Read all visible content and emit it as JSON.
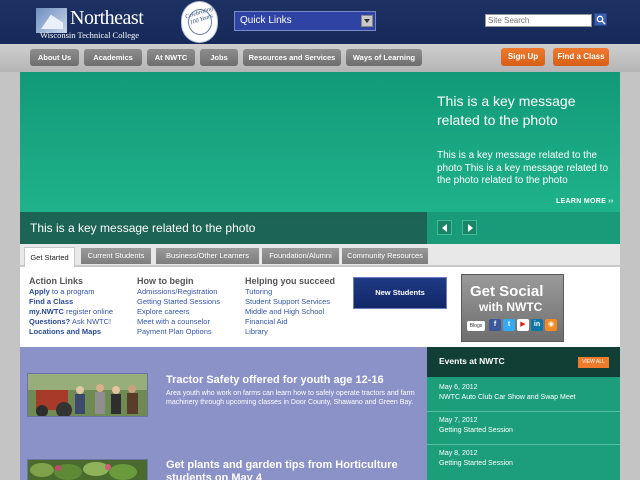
{
  "header": {
    "logo": {
      "name": "Northeast",
      "subtitle": "Wisconsin Technical College"
    },
    "seal": {
      "text": "Celebrating 100 Years"
    },
    "quick_links": {
      "label": "Quick Links"
    },
    "search": {
      "placeholder": "Site Search",
      "button_icon": "magnifier-icon"
    }
  },
  "nav": {
    "items": [
      {
        "label": "About Us"
      },
      {
        "label": "Academics"
      },
      {
        "label": "At NWTC"
      },
      {
        "label": "Jobs"
      },
      {
        "label": "Resources and Services"
      },
      {
        "label": "Ways of Learning"
      }
    ],
    "cta": [
      {
        "label": "Sign Up"
      },
      {
        "label": "Find a Class"
      }
    ]
  },
  "hero": {
    "title": "This is a key message related to the photo",
    "body": "This is a key message related to the photo This is a key message related to the photo related to the photo",
    "learn_more": "LEARN MORE ››",
    "caption": "This is a key message related to the photo",
    "controls": [
      "prev-arrow-icon",
      "next-arrow-icon"
    ]
  },
  "tabs": [
    {
      "label": "Get Started",
      "active": true
    },
    {
      "label": "Current Students",
      "active": false
    },
    {
      "label": "Business/Other Learners",
      "active": false
    },
    {
      "label": "Foundation/Alumni",
      "active": false
    },
    {
      "label": "Community Resources",
      "active": false
    }
  ],
  "panel": {
    "columns": [
      {
        "heading": "Action Links",
        "links": [
          {
            "bold": "Apply",
            "text": " to a program"
          },
          {
            "bold": "Find a Class",
            "text": ""
          },
          {
            "bold": "my.NWTC",
            "text": " register online"
          },
          {
            "bold": "Questions?",
            "text": " Ask NWTC!"
          },
          {
            "bold": "Locations and Maps",
            "text": ""
          }
        ]
      },
      {
        "heading": "How to begin",
        "links": [
          {
            "text": "Admissions/Registration"
          },
          {
            "text": "Getting Started Sessions"
          },
          {
            "text": "Explore careers"
          },
          {
            "text": "Meet with a counselor"
          },
          {
            "text": "Payment Plan Options"
          }
        ]
      },
      {
        "heading": "Helping you succeed",
        "links": [
          {
            "text": "Tutoring"
          },
          {
            "text": "Student Support Services"
          },
          {
            "text": "Middle and High School"
          },
          {
            "text": "Financial Aid"
          },
          {
            "text": "Library"
          }
        ]
      }
    ],
    "new_students": "New Students",
    "social": {
      "title": "Get Social",
      "subtitle": "with NWTC",
      "blogs": "Blogs",
      "icons": [
        "facebook-icon",
        "twitter-icon",
        "youtube-icon",
        "linkedin-icon",
        "rss-icon"
      ]
    }
  },
  "news": [
    {
      "title": "Tractor Safety offered for youth age 12-16",
      "body": "Area youth who work on farms can learn how to safely operate tractors and farm machinery through upcoming classes in Door County, Shawano and Green Bay."
    },
    {
      "title": "Get plants and garden tips from Horticulture students on May 4",
      "body": ""
    }
  ],
  "events": {
    "title": "Events at NWTC",
    "view_all": "VIEW ALL",
    "items": [
      {
        "date": "May 6, 2012",
        "name": "NWTC Auto Club Car Show and Swap Meet"
      },
      {
        "date": "May 7, 2012",
        "name": "Getting Started Session"
      },
      {
        "date": "May 8, 2012",
        "name": "Getting Started Session"
      }
    ]
  },
  "colors": {
    "header_navy": "#1d3163",
    "hero_green": "#1aa985",
    "cta_orange": "#e86d22",
    "news_lavender": "#8b92c7",
    "link_blue": "#3456a6"
  }
}
